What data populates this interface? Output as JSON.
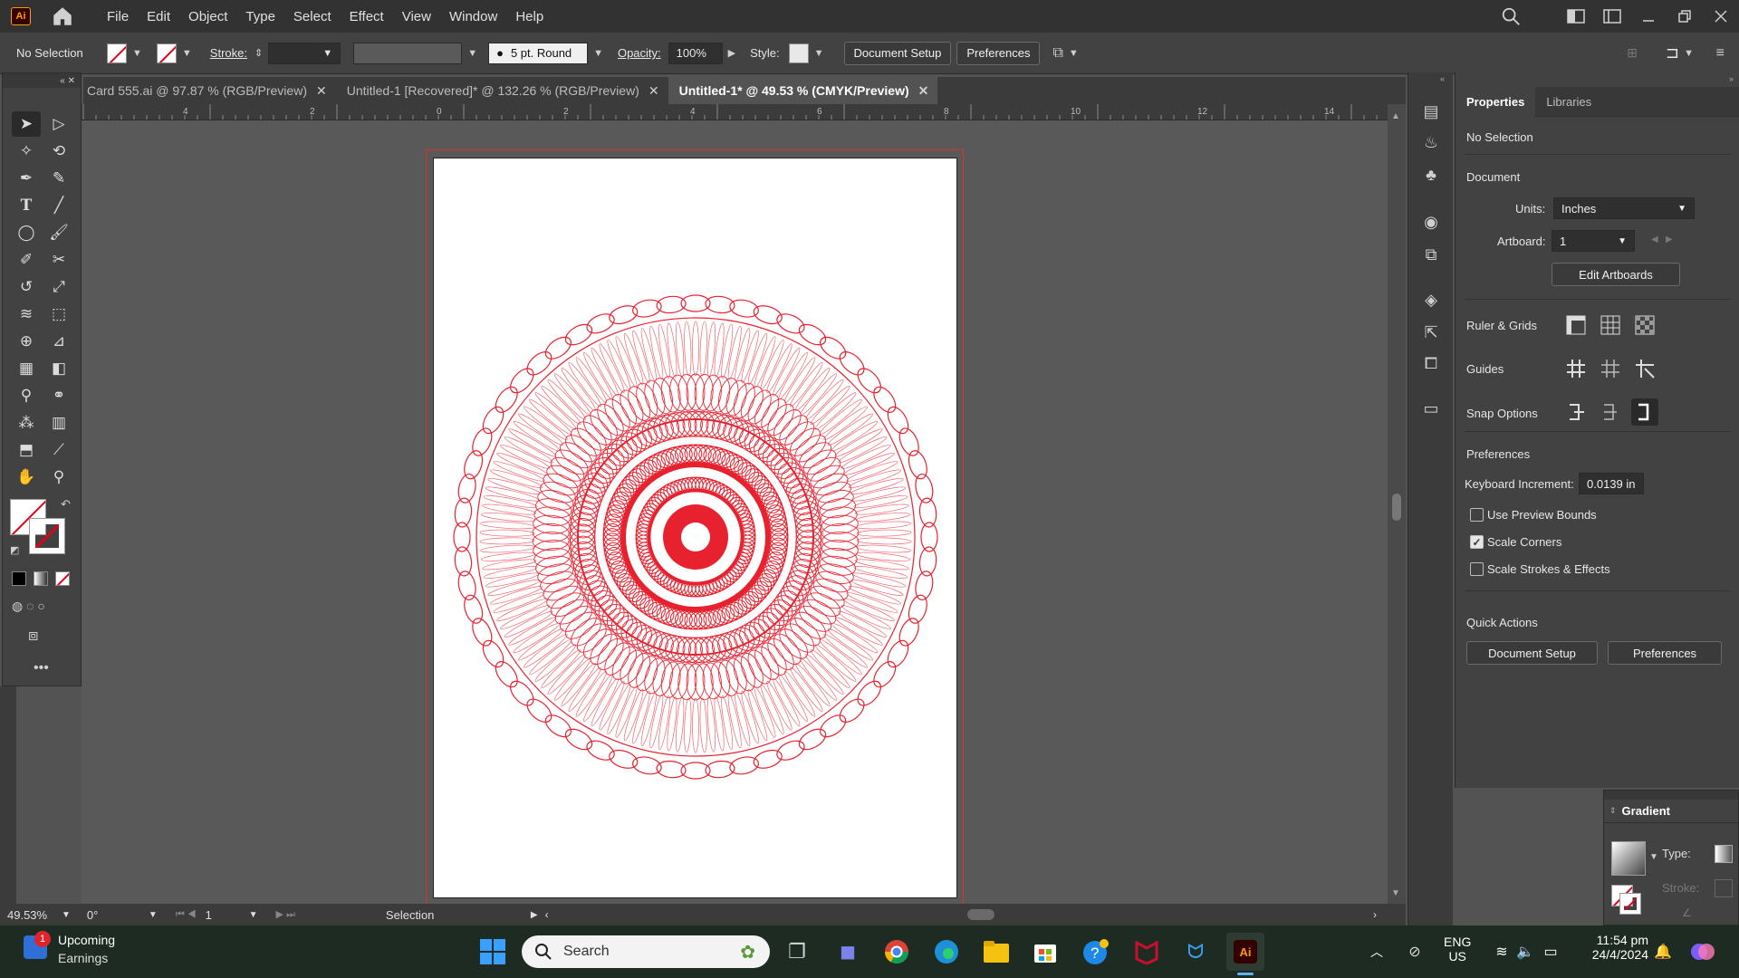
{
  "app": {
    "logo": "Ai"
  },
  "menu": [
    "File",
    "Edit",
    "Object",
    "Type",
    "Select",
    "Effect",
    "View",
    "Window",
    "Help"
  ],
  "control_bar": {
    "selection": "No Selection",
    "stroke_label": "Stroke:",
    "brush": "5 pt. Round",
    "opacity_label": "Opacity:",
    "opacity_value": "100%",
    "style_label": "Style:",
    "document_setup": "Document Setup",
    "preferences": "Preferences"
  },
  "tabs": [
    {
      "label": "Card 555.ai @ 97.87 % (RGB/Preview)",
      "active": false
    },
    {
      "label": "Untitled-1 [Recovered]* @ 132.26 % (RGB/Preview)",
      "active": false
    },
    {
      "label": "Untitled-1* @ 49.53 % (CMYK/Preview)",
      "active": true
    }
  ],
  "ruler": {
    "ticks": [
      "4",
      "2",
      "0",
      "2",
      "4",
      "6",
      "8",
      "10",
      "12",
      "14"
    ]
  },
  "status": {
    "zoom": "49.53%",
    "rotation": "0°",
    "artboard": "1",
    "tool": "Selection"
  },
  "properties": {
    "tab_properties": "Properties",
    "tab_libraries": "Libraries",
    "no_selection": "No Selection",
    "document": "Document",
    "units_label": "Units:",
    "units_value": "Inches",
    "artboard_label": "Artboard:",
    "artboard_value": "1",
    "edit_artboards": "Edit Artboards",
    "ruler_grids": "Ruler & Grids",
    "guides": "Guides",
    "snap_options": "Snap Options",
    "preferences": "Preferences",
    "keyboard_increment_label": "Keyboard Increment:",
    "keyboard_increment_value": "0.0139 in",
    "use_preview_bounds": "Use Preview Bounds",
    "scale_corners": "Scale Corners",
    "scale_strokes": "Scale Strokes & Effects",
    "quick_actions": "Quick Actions",
    "document_setup": "Document Setup",
    "preferences_btn": "Preferences"
  },
  "gradient_panel": {
    "title": "Gradient",
    "type_label": "Type:",
    "stroke_label": "Stroke:"
  },
  "taskbar": {
    "widget_title": "Upcoming",
    "widget_sub": "Earnings",
    "widget_badge": "1",
    "search": "Search",
    "lang1": "ENG",
    "lang2": "US",
    "time": "11:54 pm",
    "date": "24/4/2024"
  },
  "colors": {
    "accent_red": "#e0001b",
    "artwork_red": "#e8212e"
  }
}
